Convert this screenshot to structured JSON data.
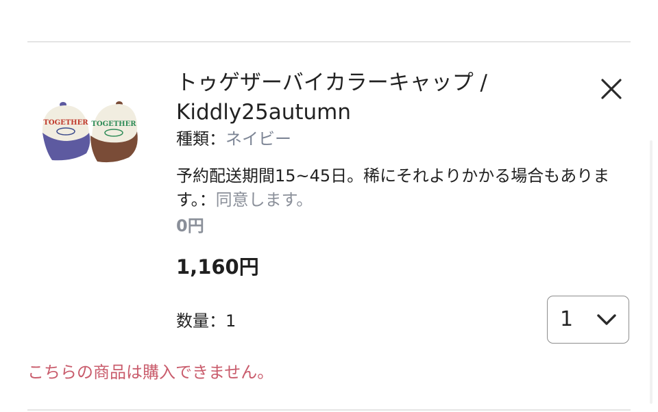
{
  "product": {
    "image_alt": "トゥゲザーバイカラーキャップ",
    "cap_text": "TOGETHER",
    "title_line1": "トゥゲザーバイカラーキャップ /",
    "title_line2": "Kiddly25autumn",
    "variant_label": "種類：",
    "variant_value": "ネイビー",
    "note_text": "予約配送期間15~45日。稀にそれよりかかる場合もあります。：",
    "note_agree": "同意します。",
    "option_price": "0円",
    "price": "1,160円",
    "quantity_label": "数量：1"
  },
  "quantity_select": {
    "value": "1",
    "icon": "chevron-down-icon"
  },
  "close_icon": "close-icon",
  "warning": "こちらの商品は購入できません。",
  "colors": {
    "warning": "#c95c6c",
    "muted": "#8a8f99",
    "variant": "#7d8595",
    "divider": "#e4e4e4",
    "cap_navy": "#5d5aa0",
    "cap_brown": "#7a4c37",
    "cap_cream": "#f1ede0"
  }
}
